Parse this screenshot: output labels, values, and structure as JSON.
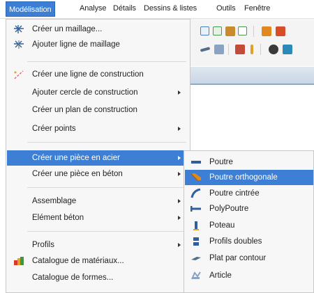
{
  "menubar": {
    "items": [
      "Modélisation",
      "Analyse",
      "Détails",
      "Dessins & listes",
      "Outils",
      "Fenêtre"
    ]
  },
  "menu": {
    "items": [
      {
        "label": "Créer un maillage...",
        "icon": "grid-icon"
      },
      {
        "label": "Ajouter ligne de maillage",
        "icon": "grid-line-icon"
      },
      {
        "label": "Créer une ligne de construction",
        "icon": "construction-line-icon"
      },
      {
        "label": "Ajouter cercle de construction",
        "submenu": true
      },
      {
        "label": "Créer un plan de construction"
      },
      {
        "label": "Créer points",
        "submenu": true
      },
      {
        "label": "Créer une pièce en acier",
        "submenu": true,
        "highlighted": true
      },
      {
        "label": "Créer une pièce en béton",
        "submenu": true
      },
      {
        "label": "Assemblage",
        "submenu": true
      },
      {
        "label": "Elément béton",
        "submenu": true
      },
      {
        "label": "Profils",
        "submenu": true
      },
      {
        "label": "Catalogue de matériaux...",
        "icon": "materials-catalog-icon"
      },
      {
        "label": "Catalogue de formes...",
        "icon": "shapes-catalog-icon"
      }
    ]
  },
  "submenu": {
    "items": [
      {
        "label": "Poutre",
        "icon": "beam-icon"
      },
      {
        "label": "Poutre orthogonale",
        "icon": "orthogonal-beam-icon",
        "highlighted": true
      },
      {
        "label": "Poutre cintrée",
        "icon": "curved-beam-icon"
      },
      {
        "label": "PolyPoutre",
        "icon": "polybeam-icon"
      },
      {
        "label": "Poteau",
        "icon": "column-icon"
      },
      {
        "label": "Profils doubles",
        "icon": "double-profile-icon"
      },
      {
        "label": "Plat par contour",
        "icon": "contour-plate-icon"
      },
      {
        "label": "Article",
        "icon": "item-icon"
      }
    ]
  },
  "colors": {
    "highlight": "#3c7fd5",
    "menu_bg": "#f7f7f7"
  }
}
